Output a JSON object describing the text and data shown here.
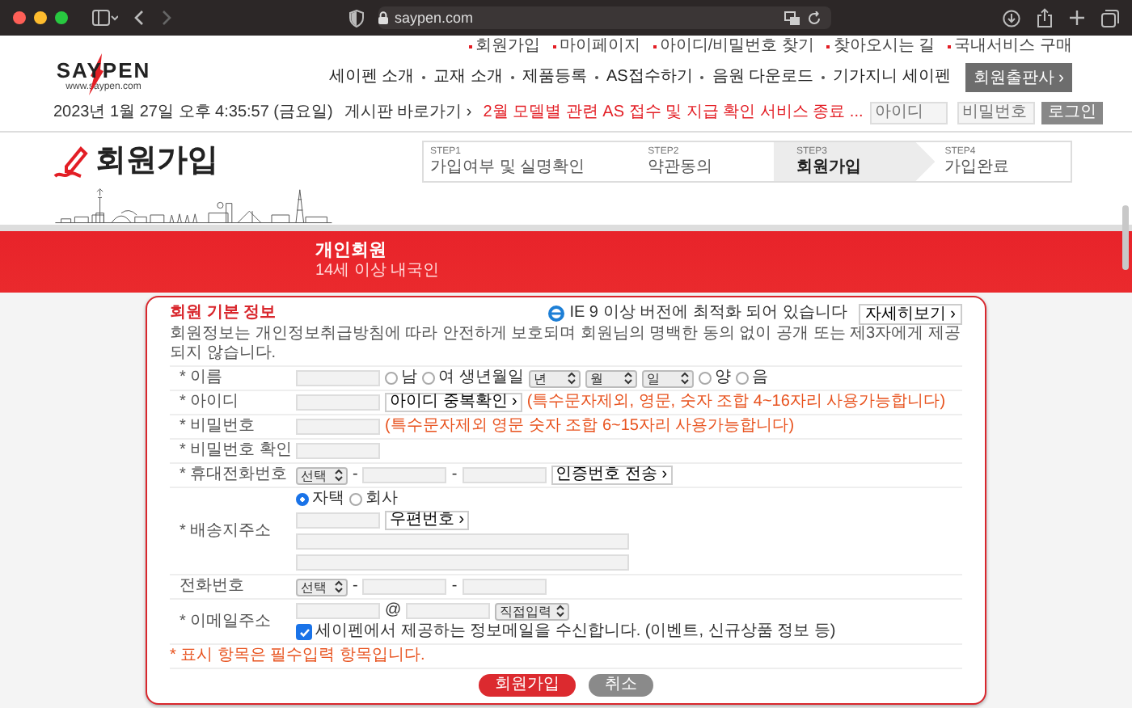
{
  "browser": {
    "url": "saypen.com"
  },
  "top_links": [
    "회원가입",
    "마이페이지",
    "아이디/비밀번호 찾기",
    "찾아오시는 길",
    "국내서비스 구매"
  ],
  "logo": {
    "name": "SAYPEN",
    "site": "www.saypen.com"
  },
  "nav": [
    "세이펜 소개",
    "교재 소개",
    "제품등록",
    "AS접수하기",
    "음원 다운로드",
    "기가지니 세이펜"
  ],
  "nav_button": "회원출판사 ›",
  "datetime": "2023년 1월 27일 오후 4:35:57 (금요일)",
  "notice": {
    "label": "게시판 바로가기 ›",
    "text": "2월 모델별 관련 AS 접수 및 지급 확인 서비스 종료 ..."
  },
  "login": {
    "id_placeholder": "아이디",
    "pw_placeholder": "비밀번호",
    "button": "로그인"
  },
  "page_title": "회원가입",
  "steps": [
    {
      "step": "STEP1",
      "title": "가입여부 및 실명확인",
      "selected": false
    },
    {
      "step": "STEP2",
      "title": "약관동의",
      "selected": false
    },
    {
      "step": "STEP3",
      "title": "회원가입",
      "selected": true
    },
    {
      "step": "STEP4",
      "title": "가입완료",
      "selected": false
    }
  ],
  "banner": {
    "title": "개인회원",
    "subtitle": "14세 이상 내국인"
  },
  "form": {
    "title": "회원 기본 정보",
    "browser_note": "IE 9 이상 버전에 최적화 되어 있습니다",
    "detail_button": "자세히보기 ›",
    "description": "회원정보는 개인정보취급방침에 따라 안전하게 보호되며 회원님의 명백한 동의 없이 공개 또는 제3자에게 제공되지 않습니다.",
    "rows": [
      {
        "label": "* 이름",
        "lines": [
          [
            {
              "kind": "input"
            },
            {
              "kind": "radio",
              "label": "남",
              "selected": false
            },
            {
              "kind": "radio",
              "label": "여",
              "selected": false
            },
            {
              "kind": "text",
              "text": "생년월일"
            },
            {
              "kind": "select",
              "value": "년"
            },
            {
              "kind": "select",
              "value": "월"
            },
            {
              "kind": "select",
              "value": "일"
            },
            {
              "kind": "radio",
              "label": "양",
              "selected": false
            },
            {
              "kind": "radio",
              "label": "음",
              "selected": false
            }
          ]
        ]
      },
      {
        "label": "* 아이디",
        "lines": [
          [
            {
              "kind": "input"
            },
            {
              "kind": "button",
              "label": "아이디 중복확인 ›"
            },
            {
              "kind": "note",
              "text": "(특수문자제외, 영문, 숫자 조합 4~16자리 사용가능합니다)"
            }
          ]
        ]
      },
      {
        "label": "* 비밀번호",
        "lines": [
          [
            {
              "kind": "input"
            },
            {
              "kind": "note",
              "text": "(특수문자제외 영문 숫자 조합 6~15자리 사용가능합니다)"
            }
          ]
        ]
      },
      {
        "label": "* 비밀번호 확인",
        "lines": [
          [
            {
              "kind": "input"
            }
          ]
        ]
      },
      {
        "label": "* 휴대전화번호",
        "lines": [
          [
            {
              "kind": "select",
              "value": "선택"
            },
            {
              "kind": "text",
              "text": "-"
            },
            {
              "kind": "input"
            },
            {
              "kind": "text",
              "text": "-"
            },
            {
              "kind": "input"
            },
            {
              "kind": "button",
              "label": "인증번호 전송 ›"
            }
          ]
        ]
      },
      {
        "label": "* 배송지주소",
        "lines": [
          [
            {
              "kind": "radio",
              "label": "자택",
              "selected": true
            },
            {
              "kind": "radio",
              "label": "회사",
              "selected": false
            }
          ],
          [
            {
              "kind": "input"
            },
            {
              "kind": "button",
              "label": "우편번호 ›"
            }
          ],
          [
            {
              "kind": "address"
            }
          ],
          [
            {
              "kind": "address"
            }
          ]
        ]
      },
      {
        "label": "전화번호",
        "lines": [
          [
            {
              "kind": "select",
              "value": "선택"
            },
            {
              "kind": "text",
              "text": "-"
            },
            {
              "kind": "input"
            },
            {
              "kind": "text",
              "text": "-"
            },
            {
              "kind": "input"
            }
          ]
        ]
      },
      {
        "label": "* 이메일주소",
        "lines": [
          [
            {
              "kind": "input"
            },
            {
              "kind": "text",
              "text": "@"
            },
            {
              "kind": "input"
            },
            {
              "kind": "select",
              "value": "직접입력"
            }
          ],
          [
            {
              "kind": "checkbox",
              "label": "세이펜에서 제공하는 정보메일을 수신합니다. (이벤트, 신규상품 정보 등)",
              "checked": true
            }
          ]
        ]
      }
    ],
    "required_note": "* 표시 항목은 필수입력 항목입니다.",
    "buttons": [
      {
        "kind": "primary",
        "label": "회원가입"
      },
      {
        "kind": "secondary",
        "label": "취소"
      }
    ]
  }
}
